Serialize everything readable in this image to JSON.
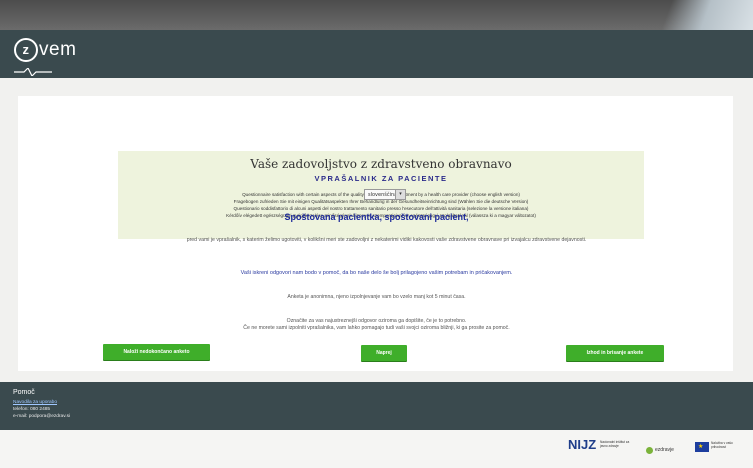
{
  "app": {
    "logo_text": "vem",
    "logo_letter": "z"
  },
  "survey": {
    "title": "Vaše zadovoljstvo z zdravstveno obravnavo",
    "subtitle": "VPRAŠALNIK ZA PACIENTE",
    "language_lines": [
      "Questionnaire satisfaction with certain aspects of the quality of your medical treatment by a health care provider (choose english version)",
      "Fragebogen zufrieden Sie mit einigen Qualitätsaspekten Ihrer Behandlung in der Gesundheitseinrichtung sind (Wählen Sie die deutsche Version)",
      "Questionario soddisfattorio di alcuni aspetti del nostro trattamento sanitario presso l'esecutore dell'attività sanitaria (selezione la versione italiana)",
      "Kérdőív elégedett egészségügyi gyógykezelése minőségének bizonyos szempontjaival az egészségügyi szolgáltatónál (válassza ki a magyar változatot)"
    ],
    "language_select": "slovenščina",
    "greeting": "Spoštovana pacientka, spoštovani pacient,",
    "paragraph_1": "pred vami je vprašalnik, s katerim želimo ugotoviti, v kolikšni meri ste zadovoljni z nekaterimi vidiki kakovosti vaše zdravstvene obravnave pri izvajalcu zdravstvene dejavnosti.",
    "paragraph_2": "Vaši iskreni odgovori nam bodo v pomoč, da bo naše delo še bolj prilagojeno vašim potrebam in pričakovanjem.",
    "paragraph_3": "Anketa je anonimna, njeno izpolnjevanje vam bo vzelo manj kot 5 minut časa.",
    "paragraph_4_line_1": "Označite za vas najustreznejši odgovor oziroma ga dopišite, če je to potrebno.",
    "paragraph_4_line_2": "Če ne morete sami izpolniti vprašalnika, vam lahko pomagajo tudi vaši svojci oziroma bližnji, ki ga prosite za pomoč."
  },
  "buttons": {
    "left": "Naloži nedokončano anketo",
    "middle": "Naprej",
    "right": "Izhod in brisanje ankete"
  },
  "footer": {
    "help_title": "Pomoč",
    "help_link": "Navodila za uporabo",
    "phone": "telefon: 080 2485",
    "email": "e-mail: podpora@ezdrav.si"
  },
  "logos": {
    "nijz": "NIJZ",
    "nijz_sub": "Nacionalni inštitut za javno zdravje",
    "zdravje": "ezdravje",
    "eu": "Naložba v vašo prihodnost"
  },
  "colors": {
    "header": "#3a4a4e",
    "button": "#3fae2a",
    "intro_bg": "#eef3dd",
    "greeting": "#1d2a9a"
  }
}
